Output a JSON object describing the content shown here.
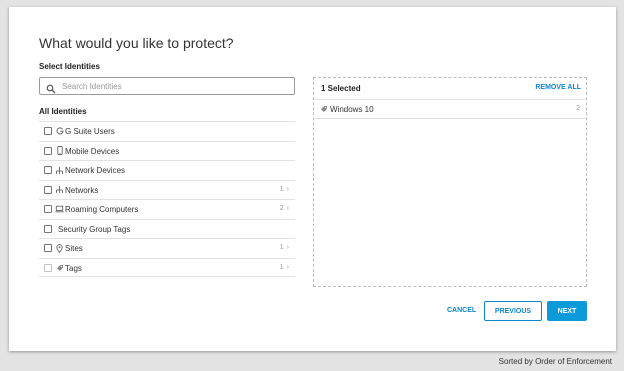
{
  "modal": {
    "title": "What would you like to protect?"
  },
  "left": {
    "select_label": "Select Identities",
    "search_placeholder": "Search Identities",
    "all_label": "All Identities",
    "items": [
      {
        "label": "G Suite Users",
        "icon": "google-g-icon",
        "count": "",
        "disabled": false
      },
      {
        "label": "Mobile Devices",
        "icon": "mobile-icon",
        "count": "",
        "disabled": false
      },
      {
        "label": "Network Devices",
        "icon": "network-icon",
        "count": "",
        "disabled": false
      },
      {
        "label": "Networks",
        "icon": "network-icon",
        "count": "1",
        "disabled": false
      },
      {
        "label": "Roaming Computers",
        "icon": "laptop-icon",
        "count": "2",
        "disabled": false
      },
      {
        "label": "Security Group Tags",
        "icon": "",
        "count": "",
        "disabled": false
      },
      {
        "label": "Sites",
        "icon": "location-pin-icon",
        "count": "1",
        "disabled": false
      },
      {
        "label": "Tags",
        "icon": "tag-icon",
        "count": "1",
        "disabled": true
      }
    ]
  },
  "right": {
    "selected_title": "1 Selected",
    "remove_all": "REMOVE ALL",
    "selected_items": [
      {
        "label": "Windows 10",
        "icon": "tag-icon",
        "count": "2"
      }
    ]
  },
  "buttons": {
    "cancel": "CANCEL",
    "previous": "PREVIOUS",
    "next": "NEXT"
  },
  "footer_note": "Sorted by Order of Enforcement",
  "colors": {
    "accent": "#0d87c8",
    "primary_button": "#0d9ad8"
  }
}
